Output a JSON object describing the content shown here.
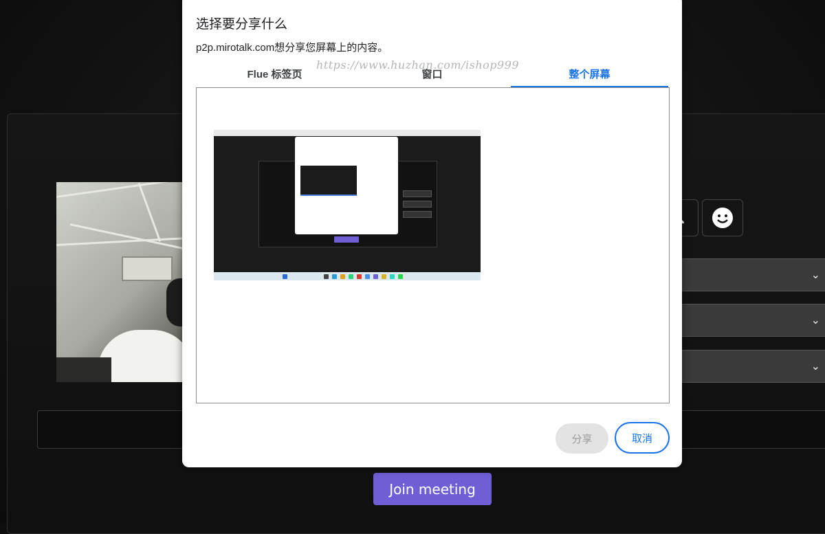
{
  "dialog": {
    "title": "选择要分享什么",
    "subtitle": "p2p.mirotalk.com想分享您屏幕上的内容。",
    "watermark": "https://www.huzhan.com/ishop999",
    "tabs": [
      {
        "label": "Flue 标签页",
        "active": false
      },
      {
        "label": "窗口",
        "active": false
      },
      {
        "label": "整个屏幕",
        "active": true
      }
    ],
    "share_label": "分享",
    "cancel_label": "取消"
  },
  "background": {
    "join_label": "Join meeting",
    "accent": "#6e5fd6"
  },
  "colors": {
    "active_tab": "#1a73e8"
  }
}
